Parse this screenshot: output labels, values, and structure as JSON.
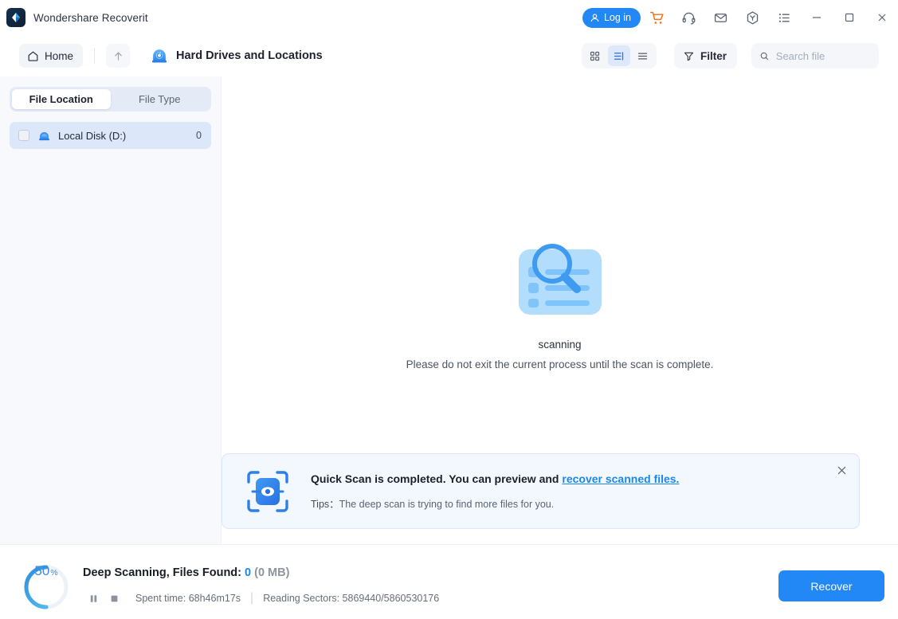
{
  "titlebar": {
    "app_name": "Wondershare Recoverit",
    "logo_icon": "wondershare-diamond-logo",
    "login_label": "Log in",
    "login_icon": "user-icon",
    "icons": [
      {
        "name": "cart-icon",
        "color": "#f07414"
      },
      {
        "name": "headset-icon",
        "color": "#5a6372"
      },
      {
        "name": "mail-icon",
        "color": "#5a6372"
      },
      {
        "name": "hexagon-y-icon",
        "color": "#5a6372"
      },
      {
        "name": "list-menu-icon",
        "color": "#5a6372"
      }
    ],
    "window_controls": [
      "minimize-icon",
      "maximize-icon",
      "close-icon"
    ]
  },
  "toolbar": {
    "home_label": "Home",
    "home_icon": "home-icon",
    "up_icon": "arrow-up-icon",
    "location_icon": "hard-drive-icon",
    "location_title": "Hard Drives and Locations",
    "views": [
      {
        "name": "grid-view",
        "icon": "grid-icon",
        "active": false
      },
      {
        "name": "detail-view",
        "icon": "detail-list-icon",
        "active": true
      },
      {
        "name": "list-view",
        "icon": "list-icon",
        "active": false
      }
    ],
    "filter_label": "Filter",
    "filter_icon": "funnel-icon",
    "search_icon": "search-icon",
    "search_placeholder": "Search file",
    "search_value": ""
  },
  "sidebar": {
    "tabs": [
      {
        "label": "File Location",
        "active": true
      },
      {
        "label": "File Type",
        "active": false
      }
    ],
    "disks": [
      {
        "label": "Local Disk (D:)",
        "count": "0",
        "icon": "disk-icon",
        "checked": false,
        "selected": true
      }
    ]
  },
  "main": {
    "illustration_icon": "scanning-magnifier-icon",
    "status": "scanning",
    "hint": "Please do not exit the current process until the scan is complete."
  },
  "banner": {
    "icon": "scan-preview-eye-icon",
    "headline": "Quick Scan is completed. You can preview and",
    "link": "recover scanned files.",
    "tips_label": "Tips：",
    "tips_text": "The deep scan is trying to find more files for you.",
    "close_icon": "close-icon"
  },
  "status_bar": {
    "progress_percent": "50",
    "percent_symbol": "%",
    "progress_value": 50,
    "title_prefix": "Deep Scanning, Files Found: ",
    "files_found": "0",
    "size": " (0 MB)",
    "pause_icon": "pause-icon",
    "stop_icon": "stop-icon",
    "spent_time": "Spent time: 68h46m17s",
    "separator": "|",
    "reading_sectors": "Reading Sectors: 5869440/5860530176",
    "recover_label": "Recover"
  },
  "colors": {
    "accent": "#2288f5",
    "link": "#1b88e8",
    "cart": "#f07414",
    "sidebar_bg": "#f7f9fc",
    "banner_bg": "#f3f8ff"
  }
}
